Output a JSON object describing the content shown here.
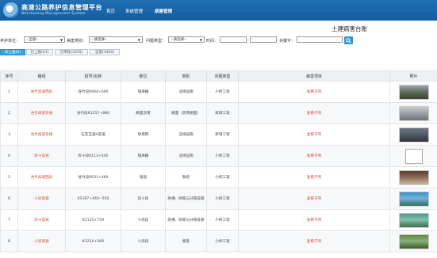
{
  "header": {
    "title": "高速公路养护信息管理平台",
    "subtitle": "Maintaining Management System",
    "nav": [
      "首页",
      "系统管理",
      "病害管理"
    ]
  },
  "page_title": "土建病害台账",
  "filters": {
    "org_label": "养护单位：",
    "org_value": "--全部--",
    "type_label": "病害类别：",
    "type_value": "--请选择--",
    "issue_label": "问题类型：",
    "issue_value": "--请选择--",
    "time_label": "时间：",
    "time_sep": "-",
    "keyword_label": "关键字："
  },
  "tabs": [
    "未上报(0)",
    "已上报(61)",
    "已审核(3455)",
    "全部(3460)"
  ],
  "table": {
    "headers": [
      "序号",
      "路线",
      "桩号/名称",
      "部位",
      "类别",
      "问题类型",
      "病害项目",
      "照片"
    ],
    "rows": [
      {
        "no": "1",
        "route": "谷竹高速西段",
        "stake": "谷竹段K664+600",
        "part": "隔离栅",
        "cat": "沿线设施",
        "issue": "小修工程",
        "item": "查看子项",
        "photo": "ph-road"
      },
      {
        "no": "2",
        "route": "谷竹高速东线",
        "stake": "谷竹段K1257+880",
        "part": "路面沥青",
        "cat": "路面（沥青路面）",
        "issue": "新增工程",
        "item": "查看子项",
        "photo": "ph-gray"
      },
      {
        "no": "3",
        "route": "谷竹高速东线",
        "stake": "石花互通A匝道",
        "part": "防落网",
        "cat": "沿线设施",
        "issue": "新增工程",
        "item": "查看子项",
        "photo": "ph-dark"
      },
      {
        "no": "4",
        "route": "房十高速",
        "stake": "房十段K113+440",
        "part": "隔离栅",
        "cat": "沿线设施",
        "issue": "小修工程",
        "item": "查看子项",
        "photo": "ph-broken"
      },
      {
        "no": "5",
        "route": "谷竹高速西段",
        "stake": "谷竹段K631+460",
        "part": "隧道",
        "cat": "隧道",
        "issue": "小修工程",
        "item": "查看子项",
        "photo": "ph-tunnel"
      },
      {
        "no": "6",
        "route": "十房高速",
        "stake": "K1187+440~550",
        "part": "房十段",
        "cat": "防撞、防眩与分隔设施",
        "issue": "小修工程",
        "item": "查看子项",
        "photo": "ph-blue"
      },
      {
        "no": "7",
        "route": "房十高速",
        "stake": "K1135+750",
        "part": "十房段",
        "cat": "防撞、防眩与分隔设施",
        "issue": "小修工程",
        "item": "查看子项",
        "photo": "ph-green"
      },
      {
        "no": "8",
        "route": "十房高速",
        "stake": "K1220+560",
        "part": "十房段",
        "cat": "路基",
        "issue": "小修工程",
        "item": "查看子项",
        "photo": "ph-bridge"
      }
    ]
  },
  "colors": {
    "header_bg": "#1f6fb4",
    "accent": "#3aa3dd",
    "link_red": "#d4452b"
  }
}
